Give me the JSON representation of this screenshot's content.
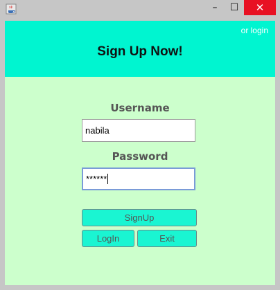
{
  "window": {
    "controls": {
      "minimize": "–",
      "maximize": "☐",
      "close": "✕"
    },
    "icon": "java-cup-icon"
  },
  "header": {
    "title": "Sign Up Now!",
    "login_link": "or login",
    "background": "#00f5d0"
  },
  "form": {
    "username_label": "Username",
    "username_value": "nabila",
    "password_label": "Password",
    "password_value": "******"
  },
  "buttons": {
    "signup": "SignUp",
    "login": "LogIn",
    "exit": "Exit"
  },
  "colors": {
    "body": "#ccffcc",
    "button": "#1af5d2",
    "close": "#e81123"
  }
}
